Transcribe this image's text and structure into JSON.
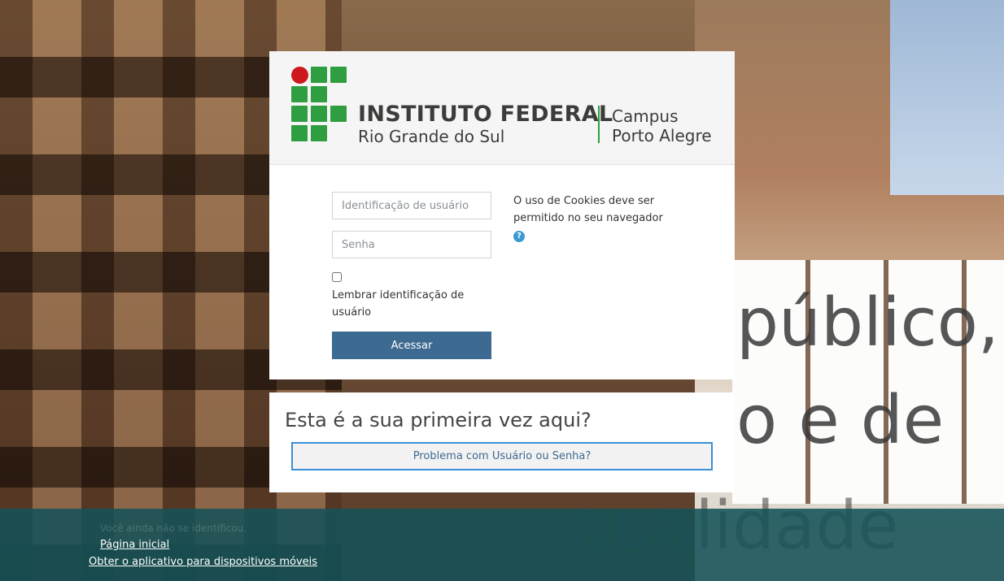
{
  "header": {
    "institution": "INSTITUTO FEDERAL",
    "subtitle": "Rio Grande do Sul",
    "campus_line1": "Campus",
    "campus_line2": "Porto Alegre",
    "logo_colors": {
      "green": "#2f9e41",
      "red": "#cd191e"
    }
  },
  "login": {
    "username_placeholder": "Identificação de usuário",
    "password_placeholder": "Senha",
    "remember_label": "Lembrar identificação de usuário",
    "remember_checked": false,
    "submit_label": "Acessar",
    "cookie_notice": "O uso de Cookies deve ser permitido no seu navegador",
    "help_icon": "question-circle-icon"
  },
  "first_time": {
    "heading": "Esta é a sua primeira vez aqui?",
    "problem_button": "Problema com Usuário ou Senha?"
  },
  "background": {
    "sign_text_1": "público,",
    "sign_text_2": "o e de",
    "sign_text_3": "qualidade"
  },
  "footer": {
    "faded_text": "Você ainda não se identificou.",
    "home_link": "Página inicial",
    "app_link": "Obter o aplicativo para dispositivos móveis"
  },
  "colors": {
    "primary_button": "#3d6a91",
    "footer_bg": "#165258"
  }
}
